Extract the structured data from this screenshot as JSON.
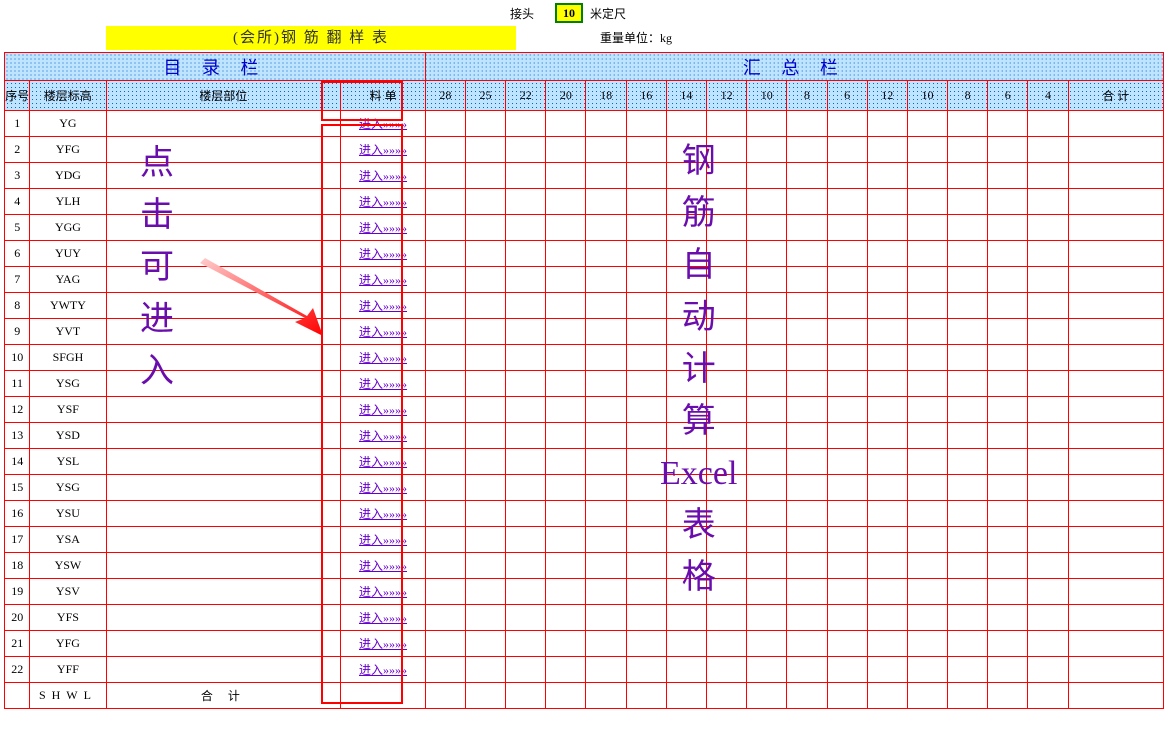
{
  "topRow": {
    "connectorLabel": "接头",
    "connectorValue": "10",
    "meterLabel": "米定尺"
  },
  "banner": "(会所)钢 筋 翻 样 表",
  "weightUnit": "重量单位：kg",
  "sectionLeft": "目    录    栏",
  "sectionRight": "汇          总          栏",
  "headers": {
    "seq": "序号",
    "level": "楼层标高",
    "position": "楼层部位",
    "bill": "料 单",
    "cols": [
      "28",
      "25",
      "22",
      "20",
      "18",
      "16",
      "14",
      "12",
      "10",
      "8",
      "6",
      "12",
      "10",
      "8",
      "6",
      "4"
    ],
    "total": "合 计"
  },
  "enterLabel": "进入»»»»",
  "rows": [
    {
      "seq": "1",
      "lv": "YG"
    },
    {
      "seq": "2",
      "lv": "YFG"
    },
    {
      "seq": "3",
      "lv": "YDG"
    },
    {
      "seq": "4",
      "lv": "YLH"
    },
    {
      "seq": "5",
      "lv": "YGG"
    },
    {
      "seq": "6",
      "lv": "YUY"
    },
    {
      "seq": "7",
      "lv": "YAG"
    },
    {
      "seq": "8",
      "lv": "YWTY"
    },
    {
      "seq": "9",
      "lv": "YVT"
    },
    {
      "seq": "10",
      "lv": "SFGH"
    },
    {
      "seq": "11",
      "lv": "YSG"
    },
    {
      "seq": "12",
      "lv": "YSF"
    },
    {
      "seq": "13",
      "lv": "YSD"
    },
    {
      "seq": "14",
      "lv": "YSL"
    },
    {
      "seq": "15",
      "lv": "YSG"
    },
    {
      "seq": "16",
      "lv": "YSU"
    },
    {
      "seq": "17",
      "lv": "YSA"
    },
    {
      "seq": "18",
      "lv": "YSW"
    },
    {
      "seq": "19",
      "lv": "YSV"
    },
    {
      "seq": "20",
      "lv": "YFS"
    },
    {
      "seq": "21",
      "lv": "YFG"
    },
    {
      "seq": "22",
      "lv": "YFF"
    }
  ],
  "sumRow": {
    "lv": "SHWL",
    "label": "合  计"
  },
  "overlay": {
    "click": "点\n击\n可\n进\n入",
    "steel": "钢\n筋\n自\n动\n计\n算\nExcel\n表\n格"
  }
}
